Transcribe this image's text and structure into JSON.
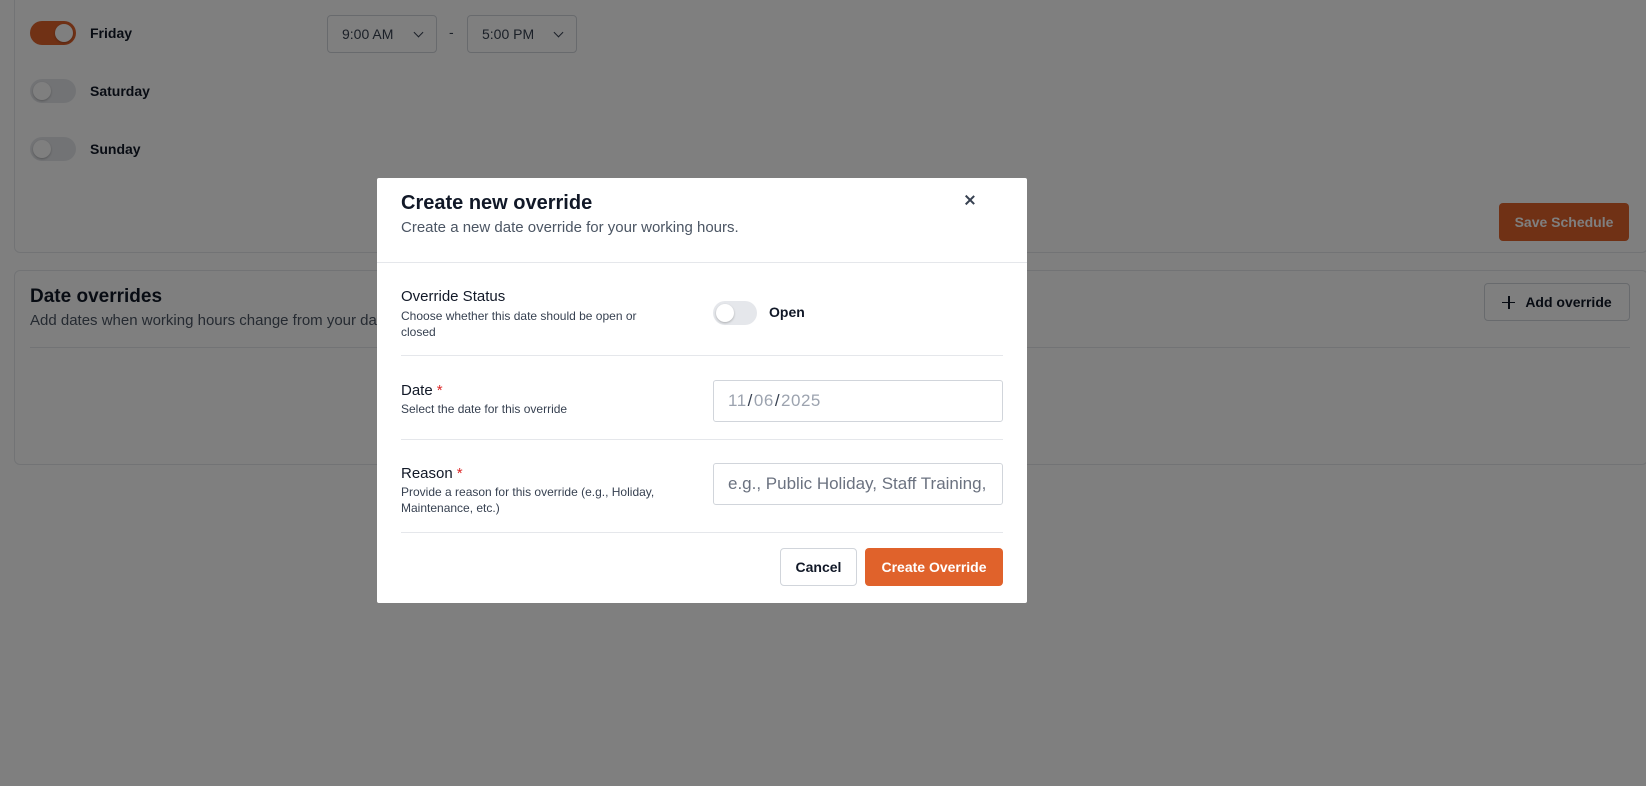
{
  "schedule": {
    "days": [
      {
        "name": "Friday",
        "enabled": true,
        "start": "9:00 AM",
        "end": "5:00 PM"
      },
      {
        "name": "Saturday",
        "enabled": false
      },
      {
        "name": "Sunday",
        "enabled": false
      }
    ],
    "time_separator": "-",
    "save_label": "Save Schedule"
  },
  "overrides": {
    "title": "Date overrides",
    "subtitle": "Add dates when working hours change from your da",
    "add_label": "Add override"
  },
  "modal": {
    "title": "Create new override",
    "description": "Create a new date override for your working hours.",
    "status": {
      "label": "Override Status",
      "help": "Choose whether this date should be open or closed",
      "toggle_on": false,
      "value_label": "Open"
    },
    "date": {
      "label": "Date",
      "required_mark": "*",
      "help": "Select the date for this override",
      "month": "11",
      "day": "06",
      "year": "2025",
      "separator": "/"
    },
    "reason": {
      "label": "Reason",
      "required_mark": "*",
      "help": "Provide a reason for this override (e.g., Holiday, Maintenance, etc.)",
      "value": "",
      "placeholder": "e.g., Public Holiday, Staff Training, etc."
    },
    "cancel_label": "Cancel",
    "create_label": "Create Override"
  },
  "colors": {
    "accent": "#e0622b",
    "required": "#dc2626",
    "overlay": "rgba(0,0,0,0.5)"
  },
  "icons": [
    "chevron-down-icon",
    "plus-icon",
    "close-icon"
  ]
}
